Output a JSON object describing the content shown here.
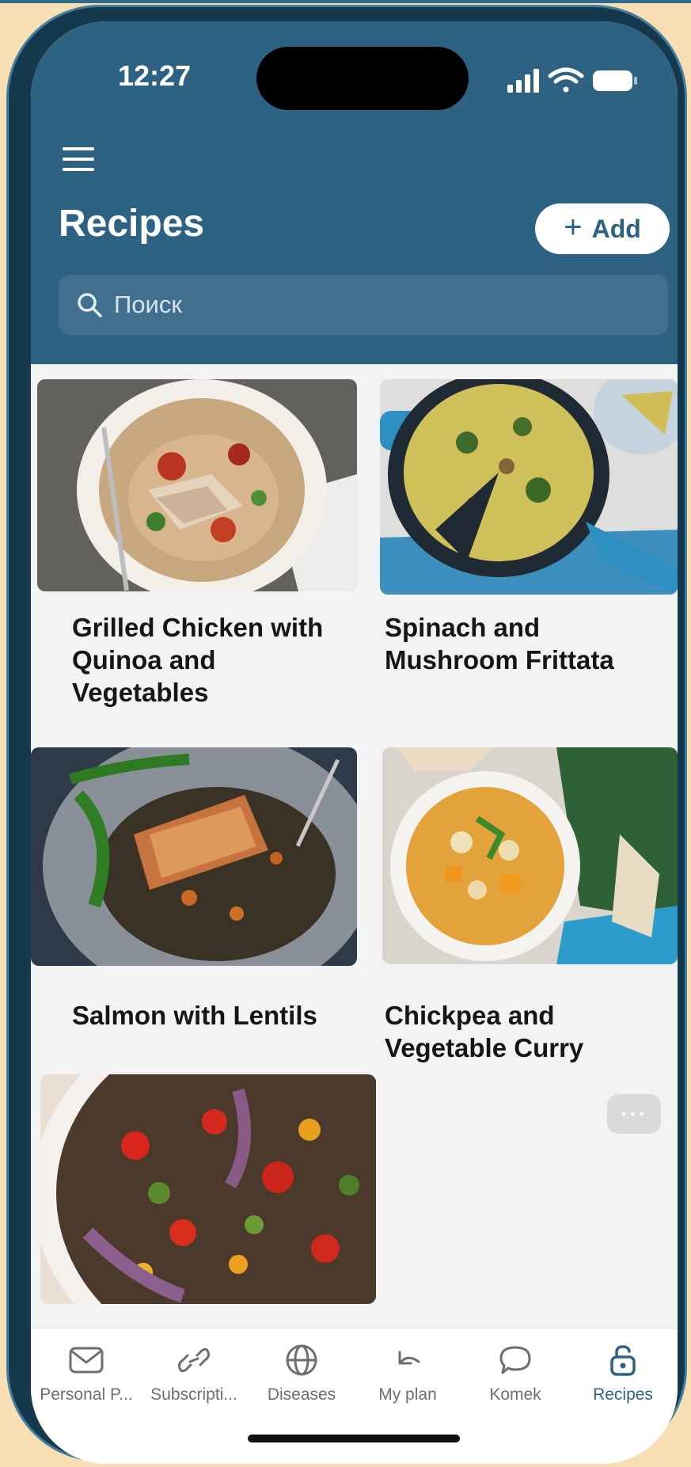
{
  "status_bar": {
    "time": "12:27"
  },
  "header": {
    "title": "Recipes",
    "add_label": "Add",
    "search_placeholder": "Поиск"
  },
  "recipes": [
    {
      "title_lines": [
        "Grilled Chicken with",
        "Quinoa and",
        "Vegetables"
      ]
    },
    {
      "title_lines": [
        "Spinach and",
        "Mushroom Frittata"
      ]
    },
    {
      "title_lines": [
        "Salmon with Lentils"
      ]
    },
    {
      "title_lines": [
        "Chickpea and",
        "Vegetable Curry"
      ]
    },
    {
      "title_lines": []
    }
  ],
  "more_label": "···",
  "tabs": [
    {
      "label": "Personal P...",
      "icon": "envelope-icon"
    },
    {
      "label": "Subscripti...",
      "icon": "link-icon"
    },
    {
      "label": "Diseases",
      "icon": "globe-icon"
    },
    {
      "label": "My plan",
      "icon": "undo-arrow-icon"
    },
    {
      "label": "Komek",
      "icon": "chat-bubble-icon"
    },
    {
      "label": "Recipes",
      "icon": "unlock-icon",
      "active": true
    }
  ],
  "colors": {
    "header": "#2e6283",
    "accent": "#2e6283",
    "inactive_tab": "#6d6d72"
  }
}
